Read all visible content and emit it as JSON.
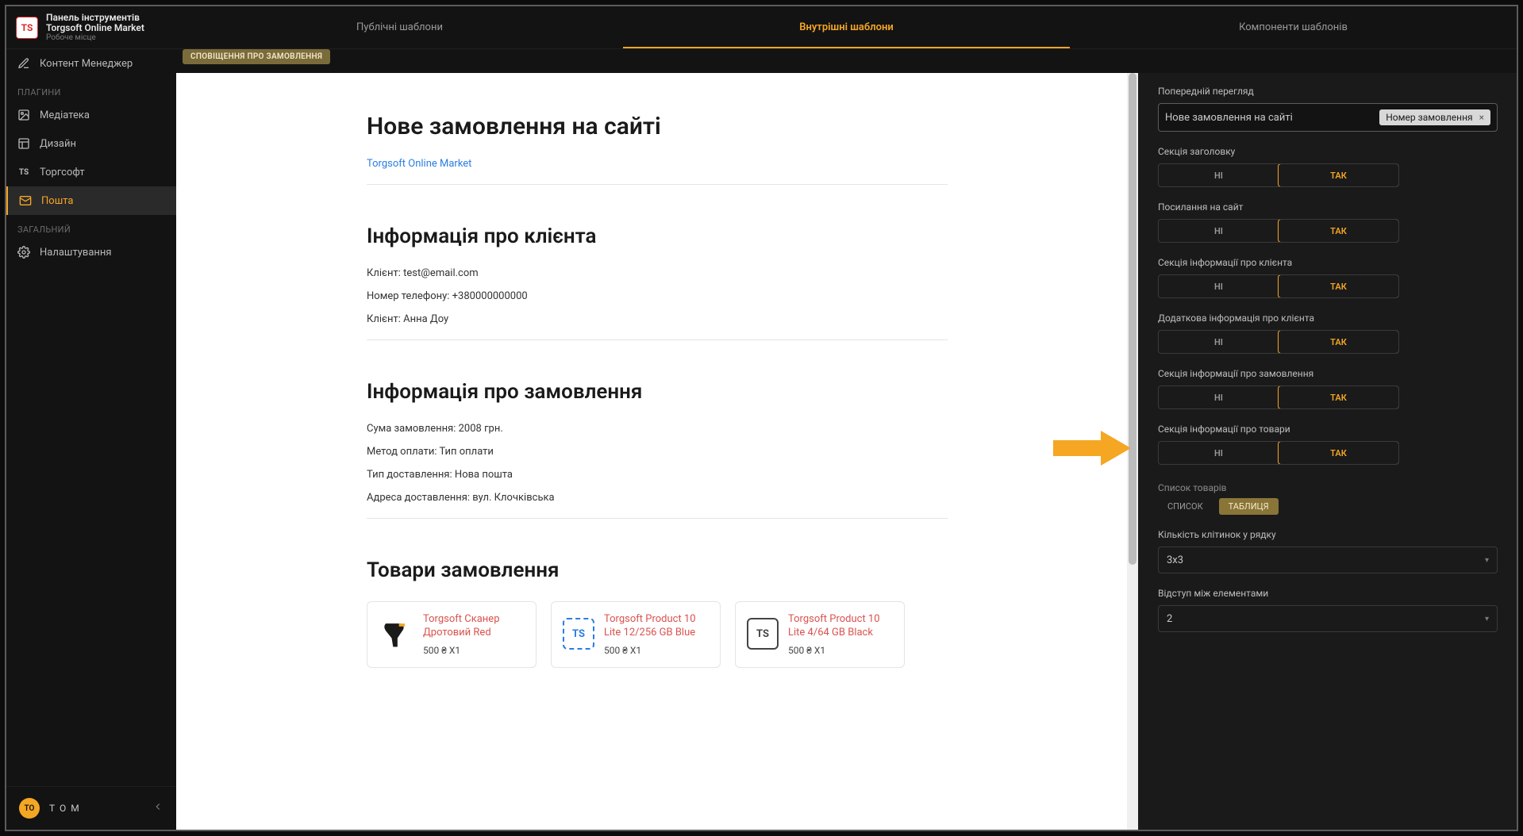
{
  "brand": {
    "logo_text": "TS",
    "title": "Панель інструментів",
    "subtitle": "Torgsoft Online Market",
    "workspace": "Робоче місце"
  },
  "tabs": {
    "public": "Публічні шаблони",
    "internal": "Внутрішні шаблони",
    "components": "Компоненти шаблонів"
  },
  "sidebar": {
    "content_manager": "Контент Менеджер",
    "section_plugins": "ПЛАГИНИ",
    "media": "Медіатека",
    "design": "Дизайн",
    "torgsoft": "Торгсофт",
    "mail": "Пошта",
    "section_general": "ЗАГАЛЬНИЙ",
    "settings": "Налаштування"
  },
  "user": {
    "initials": "TO",
    "name": "TOM"
  },
  "tag": {
    "order_notice": "СПОВІЩЕННЯ ПРО ЗАМОВЛЕННЯ"
  },
  "preview": {
    "h1": "Нове замовлення на сайті",
    "site_link": "Torgsoft Online Market",
    "h2_client": "Інформація про клієнта",
    "client_email": "Клієнт: test@email.com",
    "client_phone": "Номер телефону: +380000000000",
    "client_name": "Клієнт: Анна Доу",
    "h2_order": "Інформація про замовлення",
    "order_sum": "Сума замовлення: 2008 грн.",
    "order_method": "Метод оплати: Тип оплати",
    "order_delivery": "Тип доставлення: Нова пошта",
    "order_address": "Адреса доставлення: вул. Клочківська",
    "h2_products": "Товари замовлення",
    "products": [
      {
        "name": "Torgsoft Сканер Дротовий Red",
        "price": "500 ₴ X1"
      },
      {
        "name": "Torgsoft Product 10 Lite 12/256 GB Blue",
        "price": "500 ₴ X1"
      },
      {
        "name": "Torgsoft Product 10 Lite 4/64 GB Black",
        "price": "500 ₴ X1"
      }
    ]
  },
  "config": {
    "preview_label": "Попередній перегляд",
    "preview_value": "Нове замовлення на сайті",
    "chip_text": "Номер замовлення",
    "no": "НІ",
    "yes": "ТАК",
    "sections": {
      "header": "Секція заголовку",
      "site_link": "Посилання на сайт",
      "client_info": "Секція інформації про клієнта",
      "client_extra": "Додаткова інформація про клієнта",
      "order_info": "Секція інформації про замовлення",
      "products_info": "Секція інформації про товари"
    },
    "products_list_label": "Список товарів",
    "pill_list": "СПИСОК",
    "pill_table": "ТАБЛИЦЯ",
    "cells_per_row_label": "Кількість клітинок у рядку",
    "cells_per_row_value": "3x3",
    "gap_label": "Відступ між елементами",
    "gap_value": "2"
  }
}
